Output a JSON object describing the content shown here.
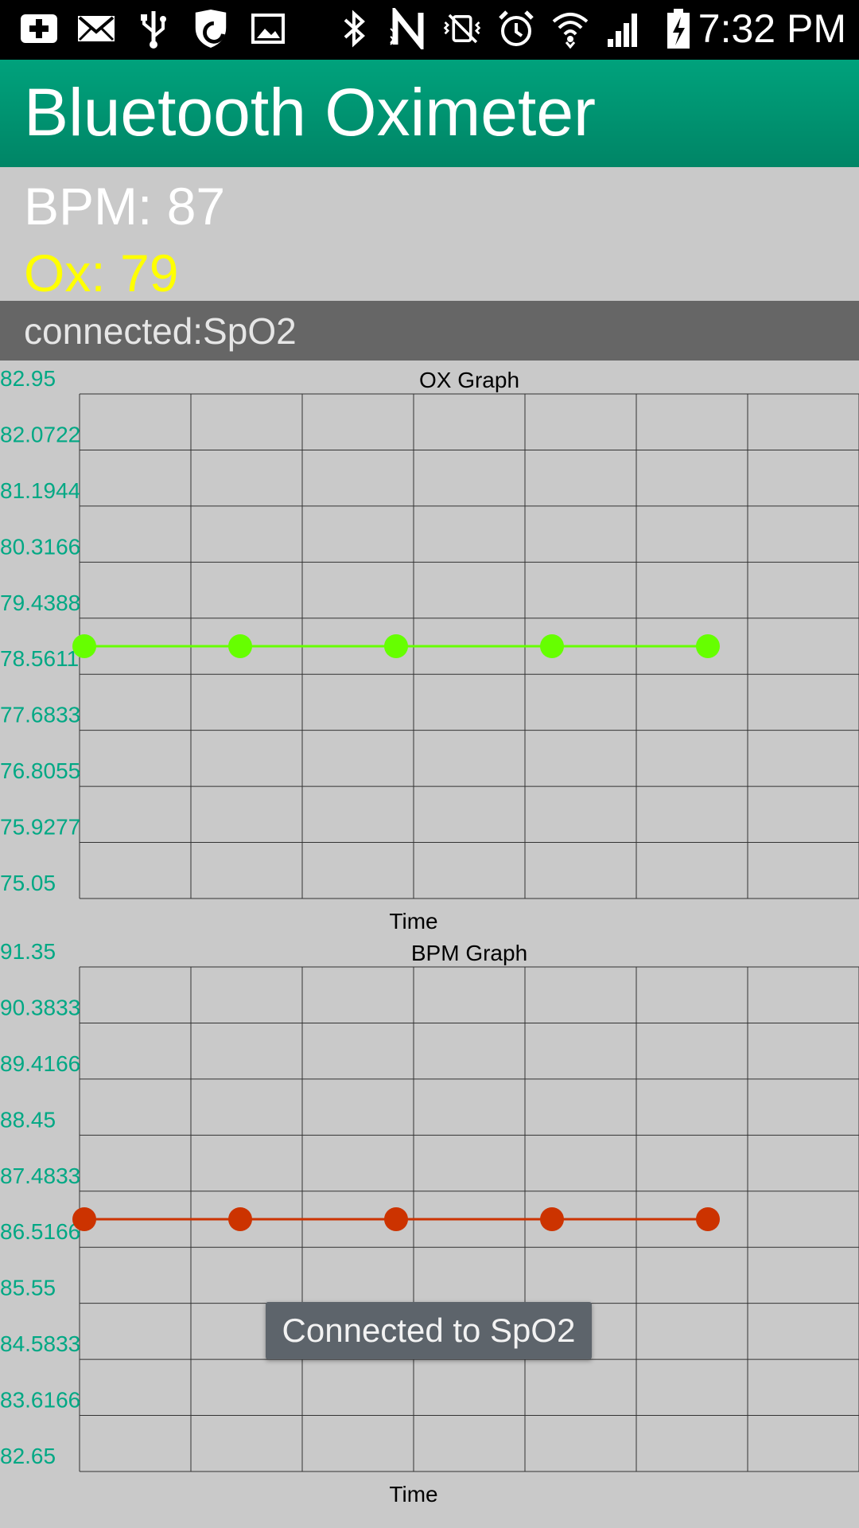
{
  "status_bar": {
    "icons_left": [
      "add-icon",
      "mail-icon",
      "usb-icon",
      "shield-icon",
      "image-icon"
    ],
    "icons_right": [
      "bluetooth-icon",
      "nfc-icon",
      "vibrate-mute-icon",
      "alarm-icon",
      "wifi-icon",
      "signal-icon",
      "battery-charging-icon"
    ],
    "time": "7:32 PM"
  },
  "app": {
    "title": "Bluetooth Oximeter"
  },
  "readouts": {
    "bpm_text": "BPM: 87",
    "ox_text": "Ox: 79",
    "bpm_color": "#ffffff",
    "ox_color": "#ffff00"
  },
  "connection": {
    "status_text": "connected:SpO2"
  },
  "toast": {
    "text": "Connected to SpO2"
  },
  "colors": {
    "accent": "#009f7a",
    "background": "#c9c9c9",
    "axis_label": "#00a884",
    "ox_series": "#66ff00",
    "bpm_series": "#cc3300"
  },
  "chart_data": [
    {
      "type": "line",
      "title": "OX Graph",
      "xlabel": "Time",
      "ylabel": "",
      "ylim": [
        75.05,
        82.95
      ],
      "y_tick_labels": [
        "82.95",
        "82.0722",
        "81.1944",
        "80.3166",
        "79.4388",
        "78.5611",
        "77.6833",
        "76.8055",
        "75.9277",
        "75.05"
      ],
      "x_divisions": 7,
      "grid": true,
      "series": [
        {
          "color": "#66ff00",
          "x": [
            0,
            1.4,
            2.8,
            4.2,
            5.6
          ],
          "values": [
            79,
            79,
            79,
            79,
            79
          ]
        }
      ]
    },
    {
      "type": "line",
      "title": "BPM Graph",
      "xlabel": "Time",
      "ylabel": "",
      "ylim": [
        82.65,
        91.35
      ],
      "y_tick_labels": [
        "91.35",
        "90.3833",
        "89.4166",
        "88.45",
        "87.4833",
        "86.5166",
        "85.55",
        "84.5833",
        "83.6166",
        "82.65"
      ],
      "x_divisions": 7,
      "grid": true,
      "series": [
        {
          "color": "#cc3300",
          "x": [
            0,
            1.4,
            2.8,
            4.2,
            5.6
          ],
          "values": [
            87,
            87,
            87,
            87,
            87
          ]
        }
      ]
    }
  ]
}
